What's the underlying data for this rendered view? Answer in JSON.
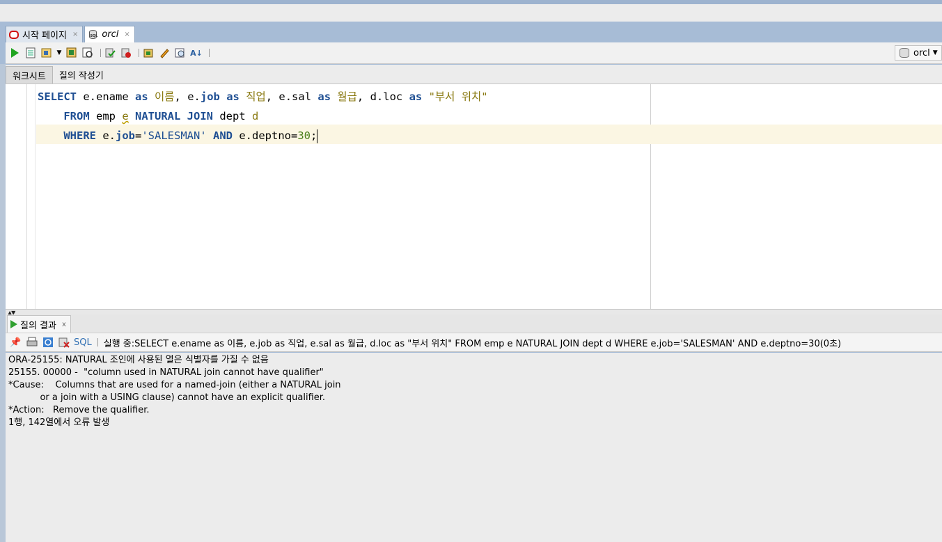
{
  "tabs": [
    {
      "label": "시작 페이지",
      "close": "×",
      "active": false
    },
    {
      "label": "orcl",
      "close": "×",
      "active": true
    }
  ],
  "toolbar": {
    "icons": [
      "run-statement-icon",
      "run-script-icon",
      "autotrace-icon",
      "dropdown-arrow-icon",
      "explain-plan-icon",
      "sql-tuning-icon",
      "commit-icon",
      "rollback-icon",
      "unshared-sql-icon",
      "clear-icon",
      "history-icon",
      "format-icon"
    ],
    "connection": "orcl"
  },
  "subtabs": [
    "워크시트",
    "질의 작성기"
  ],
  "editor": {
    "line1": {
      "select": "SELECT",
      "t1": " e.ename ",
      "as1": "as",
      "a1": " 이름",
      "t2": ", e.",
      "job": "job",
      "t3": " ",
      "as2": "as",
      "a2": " 직업",
      "t4": ", e.sal ",
      "as3": "as",
      "a3": " 월급",
      "t5": ", d.loc ",
      "as4": "as",
      "a4": " \"부서 위치\""
    },
    "line2": {
      "indent": "    ",
      "from": "FROM",
      "t1": " emp ",
      "e": "e",
      "t2": " ",
      "nj": "NATURAL JOIN",
      "t3": " dept ",
      "d": "d"
    },
    "line3": {
      "indent": "    ",
      "where": "WHERE",
      "t1": " e.",
      "job": "job",
      "t2": "=",
      "str": "'SALESMAN'",
      "t3": " ",
      "and": "AND",
      "t4": " e.deptno=",
      "num": "30",
      "t5": ";"
    }
  },
  "results": {
    "tab_label": "질의 결과",
    "tab_close": "x",
    "sql_label": "SQL",
    "status": "실행 중:SELECT e.ename as 이름, e.job as 직업, e.sal as 월급, d.loc as \"부서 위치\"    FROM emp e NATURAL JOIN dept d     WHERE e.job='SALESMAN' AND e.deptno=30(0초)",
    "lines": [
      "ORA-25155: NATURAL 조인에 사용된 열은 식별자를 가질 수 없음",
      "25155. 00000 -  \"column used in NATURAL join cannot have qualifier\"",
      "*Cause:    Columns that are used for a named-join (either a NATURAL join",
      "           or a join with a USING clause) cannot have an explicit qualifier.",
      "*Action:   Remove the qualifier.",
      "1행, 142열에서 오류 발생"
    ]
  },
  "colors": {
    "keyword": "#1f4f93",
    "alias": "#8a7a12",
    "number": "#4a7f1a",
    "frame": "#a7bcd6"
  }
}
